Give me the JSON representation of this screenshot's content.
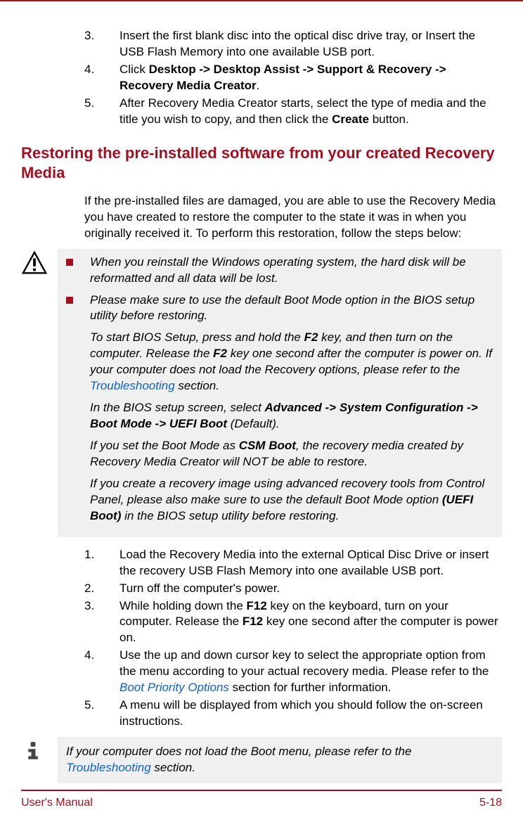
{
  "topList": {
    "items": [
      {
        "num": "3.",
        "html": "Insert the first blank disc into the optical disc drive tray, or Insert the USB Flash Memory into one available USB port."
      },
      {
        "num": "4.",
        "html": "Click <b>Desktop -> Desktop Assist -> Support & Recovery -> Recovery Media Creator</b>."
      },
      {
        "num": "5.",
        "html": "After Recovery Media Creator starts, select the type of media and the title you wish to copy, and then click the <b>Create</b> button."
      }
    ]
  },
  "heading": "Restoring the pre-installed software from your created Recovery Media",
  "intro": "If the pre-installed files are damaged, you are able to use the Recovery Media you have created to restore the computer to the state it was in when you originally received it. To perform this restoration, follow the steps below:",
  "warning": {
    "bullets": [
      "When you reinstall the Windows operating system, the hard disk will be reformatted and all data will be lost.",
      "Please make sure to use the default Boot Mode option in the BIOS setup utility before restoring."
    ],
    "paras": [
      {
        "html": "To start BIOS Setup, press and hold the <b>F2</b> key, and then turn on the computer. Release the <b>F2</b> key one second after the computer is power on. If your computer does not load the Recovery options, please refer to the <span class='link'>Troubleshooting</span> section."
      },
      {
        "html": "In the BIOS setup screen, select <b>Advanced -> System Configuration -> Boot Mode -> UEFI Boot</b> (Default)."
      },
      {
        "html": "If you set the Boot Mode as <b>CSM Boot</b>, the recovery media created by Recovery Media Creator will NOT be able to restore."
      },
      {
        "html": "If you create a recovery image using advanced recovery tools from Control Panel, please also make sure to use the default Boot Mode option <b>(UEFI Boot)</b> in the BIOS setup utility before restoring."
      }
    ]
  },
  "restoreList": {
    "items": [
      {
        "num": "1.",
        "html": "Load the Recovery Media into the external Optical Disc Drive or insert the recovery USB Flash Memory into one available USB port."
      },
      {
        "num": "2.",
        "html": "Turn off the computer's power."
      },
      {
        "num": "3.",
        "html": "While holding down the <b>F12</b> key on the keyboard, turn on your computer. Release the <b>F12</b> key one second after the computer is power on."
      },
      {
        "num": "4.",
        "html": "Use the up and down cursor key to select the appropriate option from the menu according to your actual recovery media. Please refer to the <span class='link'>Boot Priority Options</span> section for further information."
      },
      {
        "num": "5.",
        "html": "A menu will be displayed from which you should follow the on-screen instructions."
      }
    ]
  },
  "info": {
    "html": "If your computer does not load the Boot menu, please refer to the <span class='link'>Troubleshooting</span> section."
  },
  "footer": {
    "left": "User's Manual",
    "right": "5-18"
  }
}
